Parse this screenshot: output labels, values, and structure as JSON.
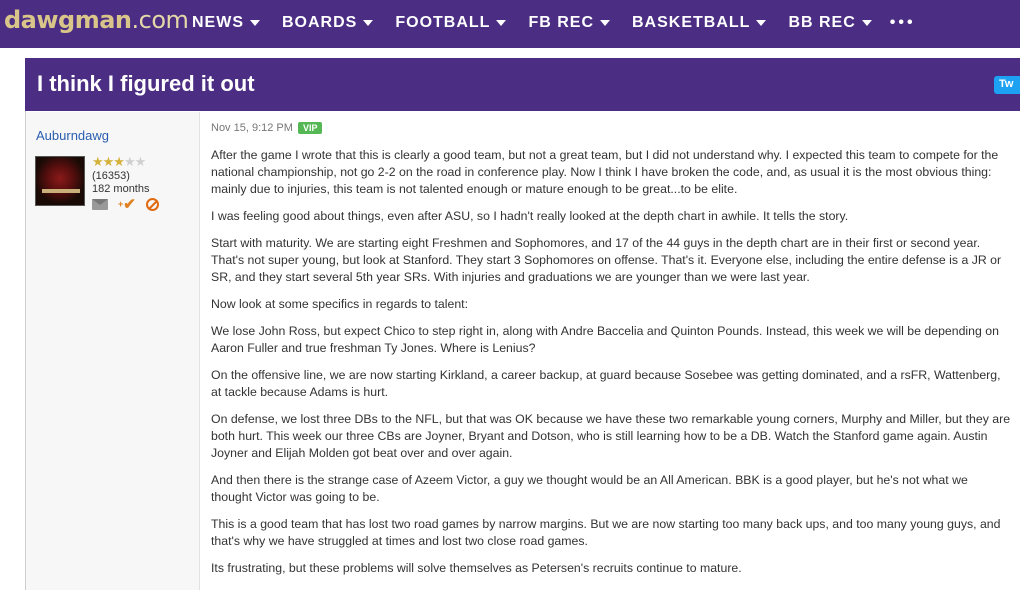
{
  "header": {
    "logo": {
      "main": "dawgman",
      "suffix": ".com"
    },
    "nav": [
      {
        "label": "NEWS"
      },
      {
        "label": "BOARDS"
      },
      {
        "label": "FOOTBALL"
      },
      {
        "label": "FB REC"
      },
      {
        "label": "BASKETBALL"
      },
      {
        "label": "BB REC"
      }
    ],
    "more": "•••"
  },
  "thread": {
    "title": "I think I figured it out",
    "tweet_label": "Tw"
  },
  "author": {
    "username": "Auburndawg",
    "stars_filled": 3,
    "stars_total": 5,
    "stars_on": "★★★",
    "stars_off": "★★",
    "post_count": "(16353)",
    "tenure": "182 months",
    "icons": [
      "mail-icon",
      "add-friend-icon",
      "block-icon"
    ]
  },
  "post": {
    "timestamp": "Nov 15, 9:12 PM",
    "badge": "VIP",
    "paragraphs": [
      "After the game I wrote that this is clearly a good team, but not a great team, but I did not understand why. I expected this team to compete for the national championship, not go 2-2 on the road in conference play. Now I think I have broken the code, and, as usual it is the most obvious thing: mainly due to injuries, this team is not talented enough or mature enough to be great...to be elite.",
      "I was feeling good about things, even after ASU, so I hadn't really looked at the depth chart in awhile. It tells the story.",
      "Start with maturity. We are starting eight Freshmen and Sophomores, and 17 of the 44 guys in the depth chart are in their first or second year. That's not super young, but look at Stanford. They start 3 Sophomores on offense. That's it. Everyone else, including the entire defense is a JR or SR, and they start several 5th year SRs. With injuries and graduations we are younger than we were last year.",
      "Now look at some specifics in regards to talent:",
      "We lose John Ross, but expect Chico to step right in, along with Andre Baccelia and Quinton Pounds. Instead, this week we will be depending on Aaron Fuller and true freshman Ty Jones. Where is Lenius?",
      "On the offensive line, we are now starting Kirkland, a career backup, at guard because Sosebee was getting dominated, and a rsFR, Wattenberg, at tackle because Adams is hurt.",
      "On defense, we lost three DBs to the NFL, but that was OK because we have these two remarkable young corners, Murphy and Miller, but they are both hurt. This week our three CBs are Joyner, Bryant and Dotson, who is still learning how to be a DB. Watch the Stanford game again. Austin Joyner and Elijah Molden got beat over and over again.",
      "And then there is the strange case of Azeem Victor, a guy we thought would be an All American. BBK is a good player, but he's not what we thought Victor was going to be.",
      "This is a good team that has lost two road games by narrow margins. But we are now starting too many back ups, and too many young guys, and that's why we have struggled at times and lost two close road games.",
      "Its frustrating, but these problems will solve themselves as Petersen's recruits continue to mature."
    ]
  },
  "colors": {
    "brand_purple": "#4b2e83",
    "brand_gold": "#d9c58a",
    "vip_green": "#56b854",
    "link_blue": "#2a5db0"
  }
}
